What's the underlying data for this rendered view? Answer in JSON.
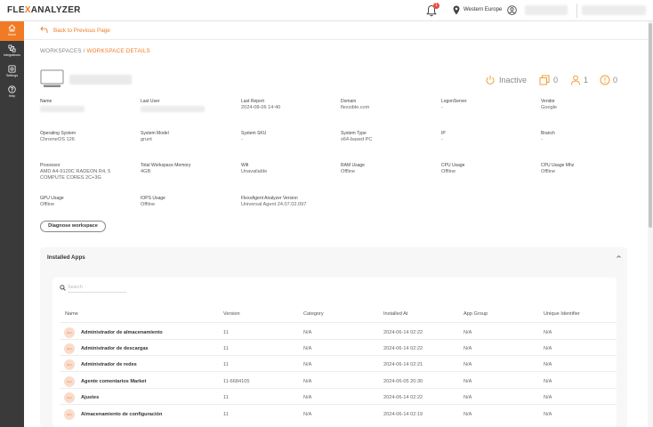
{
  "app": {
    "logo_left": "FLE",
    "logo_x": "X",
    "logo_right": "ANALYZER",
    "notification_count": "1",
    "region": "Western Europe"
  },
  "sidebar": {
    "items": [
      {
        "label": "Home",
        "icon": "home-icon",
        "active": true
      },
      {
        "label": "Integrations",
        "icon": "integrations-icon"
      },
      {
        "label": "Settings",
        "icon": "settings-icon"
      },
      {
        "label": "Help",
        "icon": "help-icon"
      }
    ]
  },
  "nav": {
    "back_label": "Back to Previous Page"
  },
  "breadcrumb": {
    "root": "WORKSPACES",
    "separator": "/",
    "current": "WORKSPACE DETAILS"
  },
  "device": {
    "status": "Inactive",
    "counts": {
      "windows": "0",
      "users": "1",
      "alerts": "0"
    }
  },
  "details": {
    "name": {
      "label": "Name",
      "value": ""
    },
    "last_user": {
      "label": "Last User",
      "value": ""
    },
    "last_report": {
      "label": "Last Report",
      "value": "2024-08-06 14:40"
    },
    "domain": {
      "label": "Domain",
      "value": "flexxible.com"
    },
    "logon_server": {
      "label": "LogonServer",
      "value": "-"
    },
    "vendor": {
      "label": "Vendor",
      "value": "Google"
    },
    "os": {
      "label": "Operating System",
      "value": "ChromeOS 126"
    },
    "system_model": {
      "label": "System Model",
      "value": "grunt"
    },
    "system_sku": {
      "label": "System SKU",
      "value": "-"
    },
    "system_type": {
      "label": "System Type",
      "value": "x64-based PC"
    },
    "ip": {
      "label": "IP",
      "value": "-"
    },
    "branch": {
      "label": "Branch",
      "value": "-"
    },
    "processor": {
      "label": "Processor",
      "value": "AMD A4-9120C RADEON R4, 5 COMPUTE CORES 2C+3G"
    },
    "total_memory": {
      "label": "Total Workspace Memory",
      "value": "4GB"
    },
    "wifi": {
      "label": "Wifi",
      "value": "Unavailable"
    },
    "ram_usage": {
      "label": "RAM Usage",
      "value": "Offline"
    },
    "cpu_usage": {
      "label": "CPU Usage",
      "value": "Offline"
    },
    "cpu_usage_mhz": {
      "label": "CPU Usage Mhz",
      "value": "Offline"
    },
    "gpu_usage": {
      "label": "GPU Usage",
      "value": "Offline"
    },
    "iops_usage": {
      "label": "IOPS Usage",
      "value": "Offline"
    },
    "agent_version": {
      "label": "FlexxAgent Analyzer Version",
      "value": "Universal Agent 24.07.02.097"
    }
  },
  "actions": {
    "diagnose_label": "Diagnose workspace"
  },
  "apps": {
    "title": "Installed Apps",
    "search_placeholder": "Search",
    "icon_text": "icon",
    "columns": [
      "Name",
      "Version",
      "Category",
      "Installed At",
      "App Group",
      "Unique Identifier"
    ],
    "rows": [
      {
        "name": "Administrador de almacenamiento",
        "version": "11",
        "category": "N/A",
        "installed_at": "2024-06-14 02:22",
        "app_group": "N/A",
        "uid": "N/A"
      },
      {
        "name": "Administrador de descargas",
        "version": "11",
        "category": "N/A",
        "installed_at": "2024-06-14 02:22",
        "app_group": "N/A",
        "uid": "N/A"
      },
      {
        "name": "Administrador de redes",
        "version": "11",
        "category": "N/A",
        "installed_at": "2024-06-14 02:21",
        "app_group": "N/A",
        "uid": "N/A"
      },
      {
        "name": "Agente comentarios Market",
        "version": "11-6684105",
        "category": "N/A",
        "installed_at": "2024-06-05 20:30",
        "app_group": "N/A",
        "uid": "N/A"
      },
      {
        "name": "Ajustes",
        "version": "11",
        "category": "N/A",
        "installed_at": "2024-06-14 02:22",
        "app_group": "N/A",
        "uid": "N/A"
      },
      {
        "name": "Almacenamiento de configuración",
        "version": "11",
        "category": "N/A",
        "installed_at": "2024-06-14 02:19",
        "app_group": "N/A",
        "uid": "N/A"
      }
    ]
  },
  "colors": {
    "accent": "#f07b24",
    "sidebar": "#3a3a3a"
  }
}
